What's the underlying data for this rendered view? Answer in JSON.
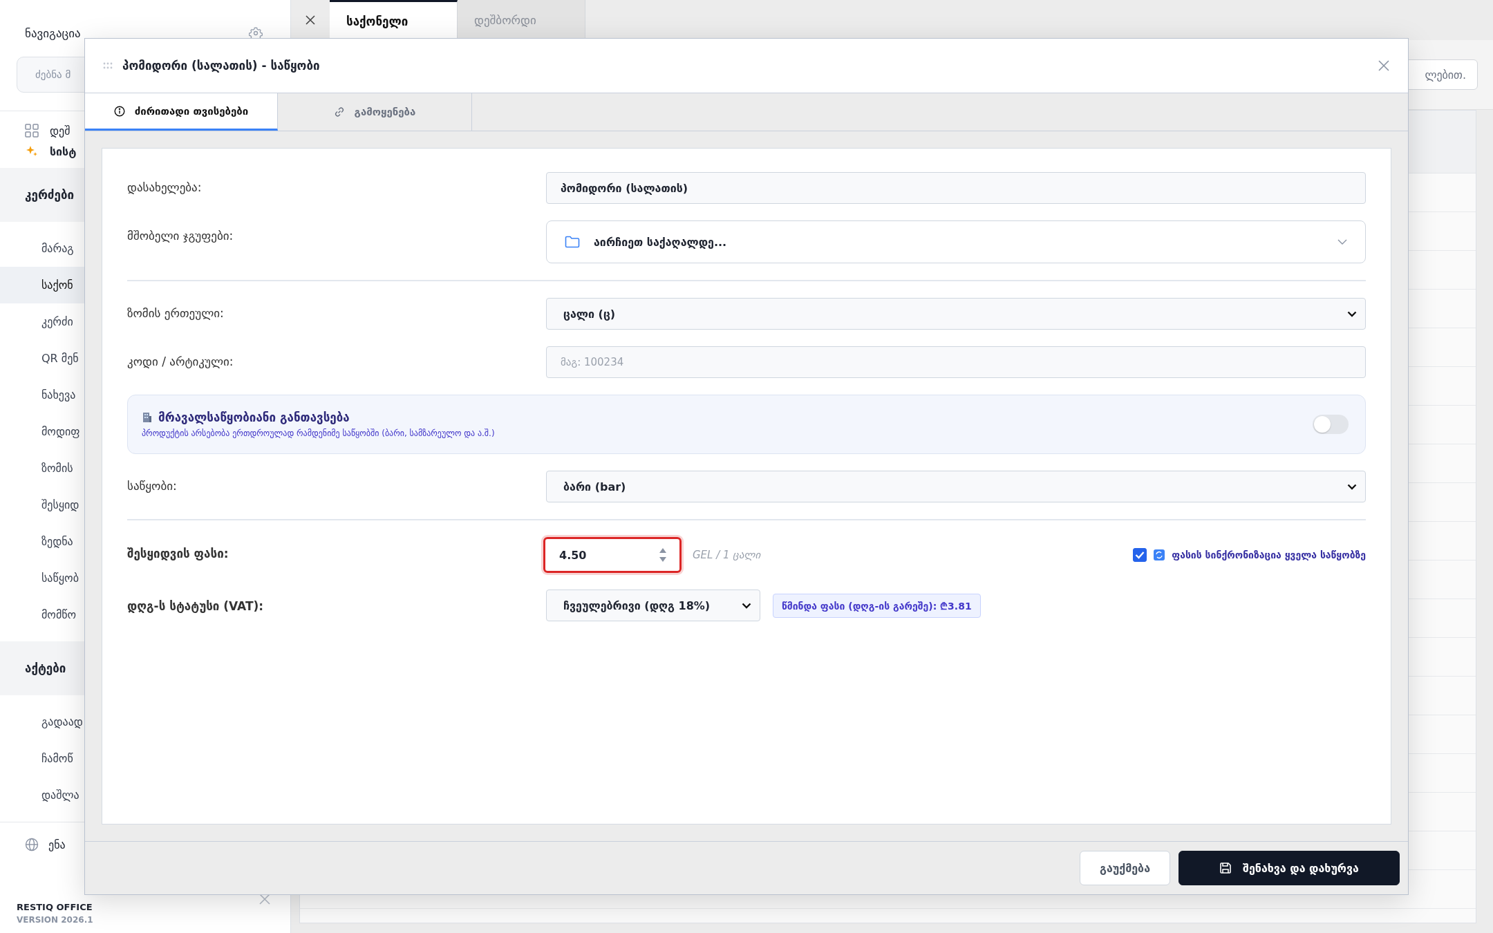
{
  "sidebar": {
    "title": "ნავიგაცია",
    "search": {
      "placeholder": "ძებნა მ"
    },
    "top_items": [
      {
        "label": "დეშ"
      },
      {
        "label": "სისტ"
      }
    ],
    "sections": [
      {
        "title": "კერძები",
        "items": [
          {
            "label": "მარაგ",
            "selected": false
          },
          {
            "label": "საქონ",
            "selected": true
          },
          {
            "label": "კერძი",
            "selected": false
          },
          {
            "label": "QR მენ",
            "selected": false
          },
          {
            "label": "ნახევა",
            "selected": false
          },
          {
            "label": "მოდიფ",
            "selected": false
          },
          {
            "label": "ზომის",
            "selected": false
          },
          {
            "label": "შესყიდ",
            "selected": false
          },
          {
            "label": "ზედნა",
            "selected": false
          },
          {
            "label": "საწყობ",
            "selected": false
          },
          {
            "label": "მომწო",
            "selected": false
          }
        ]
      },
      {
        "title": "აქტები",
        "items": [
          {
            "label": "გადაად",
            "selected": false
          },
          {
            "label": "ჩამოწ",
            "selected": false
          },
          {
            "label": "დაშლა",
            "selected": false
          }
        ]
      }
    ],
    "language": "ენა",
    "brand": "RESTIQ OFFICE",
    "version": "VERSION 2026.1"
  },
  "tabs": [
    {
      "label": "საქონელი",
      "selected": true
    },
    {
      "label": "დეშბორდი",
      "selected": false
    }
  ],
  "search": {
    "placeholder": "ლებით."
  },
  "dialog": {
    "title": "პომიდორი (სალათის) - საწყობი",
    "tabs": [
      {
        "label": "ძირითადი თვისებები",
        "selected": true
      },
      {
        "label": "გამოყენება",
        "selected": false
      }
    ],
    "fields": [
      {
        "kind": "input",
        "label": "დასახელება:",
        "value": "პომიდორი (სალათის)"
      },
      {
        "kind": "folder",
        "label": "მშობელი ჯგუფები:",
        "value": "აირჩიეთ საქაღალდე..."
      },
      {
        "kind": "divider"
      },
      {
        "kind": "select",
        "label": "ზომის ერთეული:",
        "value": "ცალი (ც)"
      },
      {
        "kind": "input",
        "label": "კოდი / არტიკული:",
        "placeholder": "მაგ: 100234"
      },
      {
        "kind": "toggle",
        "title": "მრავალსაწყობიანი განთავსება",
        "description": "პროდუქტის არსებობა ერთდროულად რამდენიმე საწყობში (ბარი, სამზარეულო და ა.შ.)",
        "on": false
      },
      {
        "kind": "select",
        "label": "საწყობი:",
        "value": "ბარი (bar)"
      },
      {
        "kind": "divider"
      },
      {
        "kind": "price",
        "label": "შესყიდვის ფასი:",
        "value": "4.50",
        "unit": "GEL / 1 ცალი",
        "sync": {
          "label": "ფასის სინქრონიზაცია ყველა საწყობზე",
          "checked": true
        }
      },
      {
        "kind": "vat",
        "label": "დღგ-ს სტატუსი (VAT):",
        "value": "ჩვეულებრივი (დღგ 18%)",
        "note": "წმინდა ფასი (დღგ-ის გარეშე): ₾3.81"
      }
    ],
    "buttons": [
      {
        "label": "გაუქმება",
        "kind": "secondary"
      },
      {
        "label": "შენახვა და დახურვა",
        "kind": "primary"
      }
    ]
  }
}
